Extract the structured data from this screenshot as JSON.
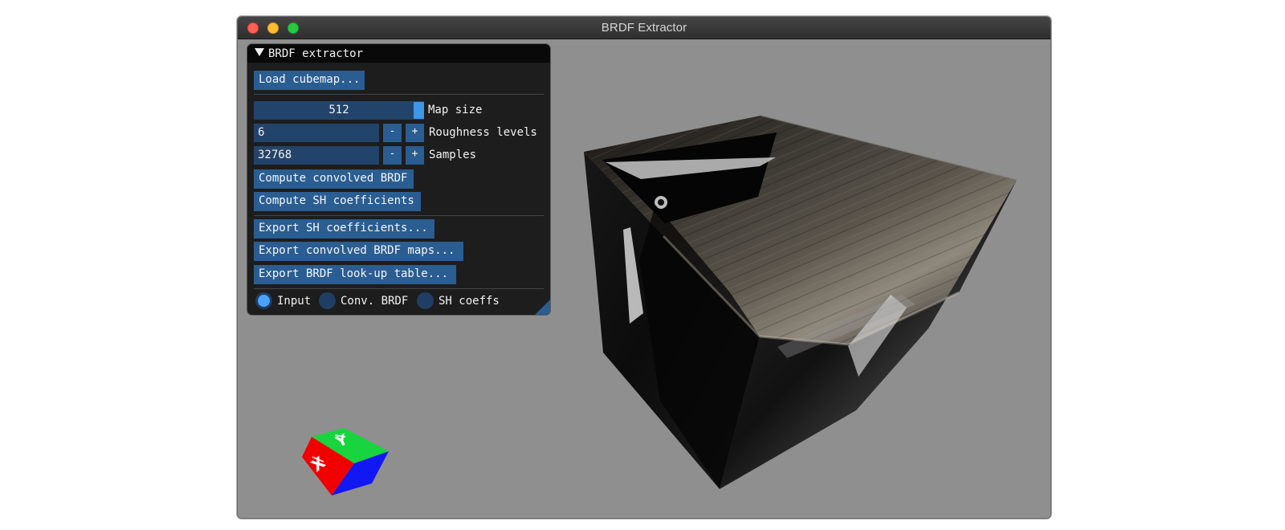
{
  "window": {
    "title": "BRDF Extractor"
  },
  "panel": {
    "title": "BRDF extractor",
    "load_cubemap": "Load cubemap...",
    "map_size_value": "512",
    "map_size_label": "Map size",
    "roughness_value": "6",
    "roughness_label": "Roughness levels",
    "samples_value": "32768",
    "samples_label": "Samples",
    "minus": "-",
    "plus": "+",
    "compute_brdf": "Compute convolved BRDF",
    "compute_sh": "Compute SH coefficients",
    "export_sh": "Export SH coefficients...",
    "export_brdf_maps": "Export convolved BRDF maps...",
    "export_lut": "Export BRDF look-up table...",
    "radio_input": "Input",
    "radio_brdf": "Conv. BRDF",
    "radio_sh": "SH coeffs"
  },
  "gizmo": {
    "x_label": "X",
    "y_label": "Y"
  },
  "colors": {
    "accent": "#2a5d91",
    "active_radio": "#4aa3ff",
    "background": "#8f8f8f"
  }
}
